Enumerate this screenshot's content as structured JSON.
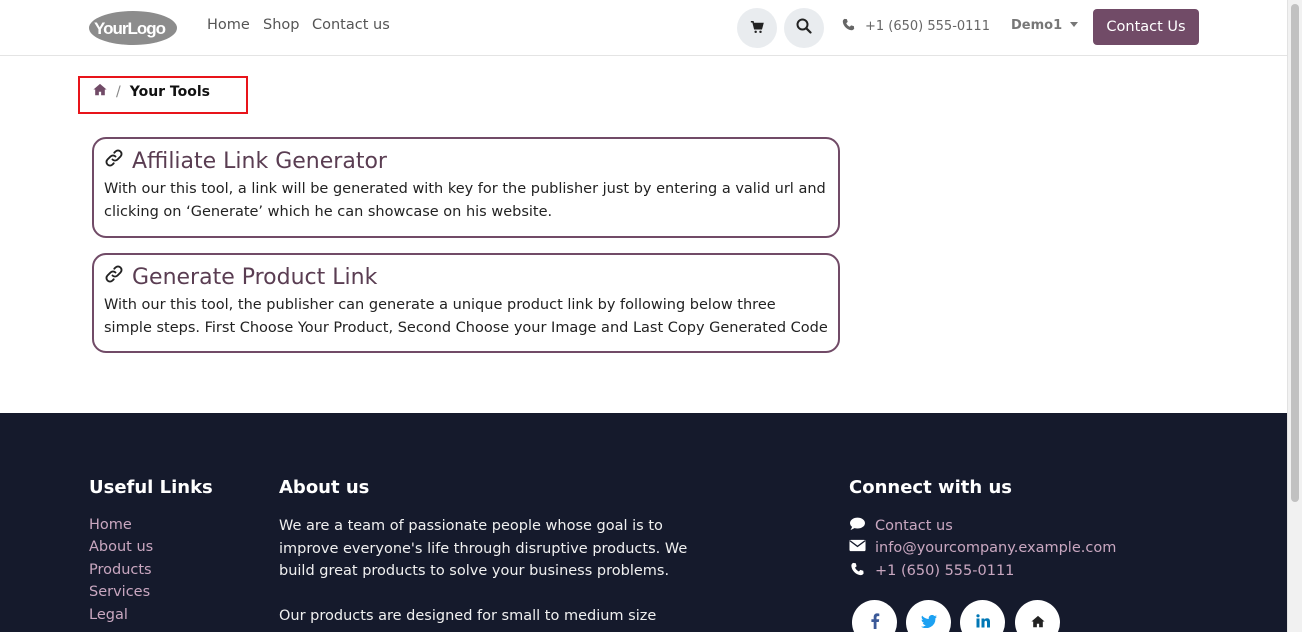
{
  "header": {
    "logo_text": "YourLogo",
    "nav": [
      "Home",
      "Shop",
      "Contact us"
    ],
    "phone": "+1 (650) 555-0111",
    "user": "Demo1",
    "cta_label": "Contact Us"
  },
  "breadcrumb": {
    "separator": "/",
    "current": "Your Tools"
  },
  "cards": [
    {
      "title": "Affiliate Link Generator",
      "description": "With our this tool, a link will be generated with key for the publisher just by entering a valid url and clicking on ‘Generate’ which he can showcase on his website."
    },
    {
      "title": "Generate Product Link",
      "description": "With our this tool, the publisher can generate a unique product link by following below three simple steps. First Choose Your Product, Second Choose your Image and Last Copy Generated Code"
    }
  ],
  "footer": {
    "useful_links": {
      "heading": "Useful Links",
      "items": [
        "Home",
        "About us",
        "Products",
        "Services",
        "Legal"
      ]
    },
    "about": {
      "heading": "About us",
      "p1": "We are a team of passionate people whose goal is to improve everyone's life through disruptive products. We build great products to solve your business problems.",
      "p2": "Our products are designed for small to medium size companies"
    },
    "connect": {
      "heading": "Connect with us",
      "contact": "Contact us",
      "email": "info@yourcompany.example.com",
      "phone": "+1 (650) 555-0111"
    },
    "social_icons": [
      "facebook-icon",
      "twitter-icon",
      "linkedin-icon",
      "home-icon"
    ]
  },
  "colors": {
    "brand": "#714b67",
    "footer_bg": "#151a2c",
    "footer_link": "#c9a7c0",
    "highlight": "#e8141a"
  }
}
